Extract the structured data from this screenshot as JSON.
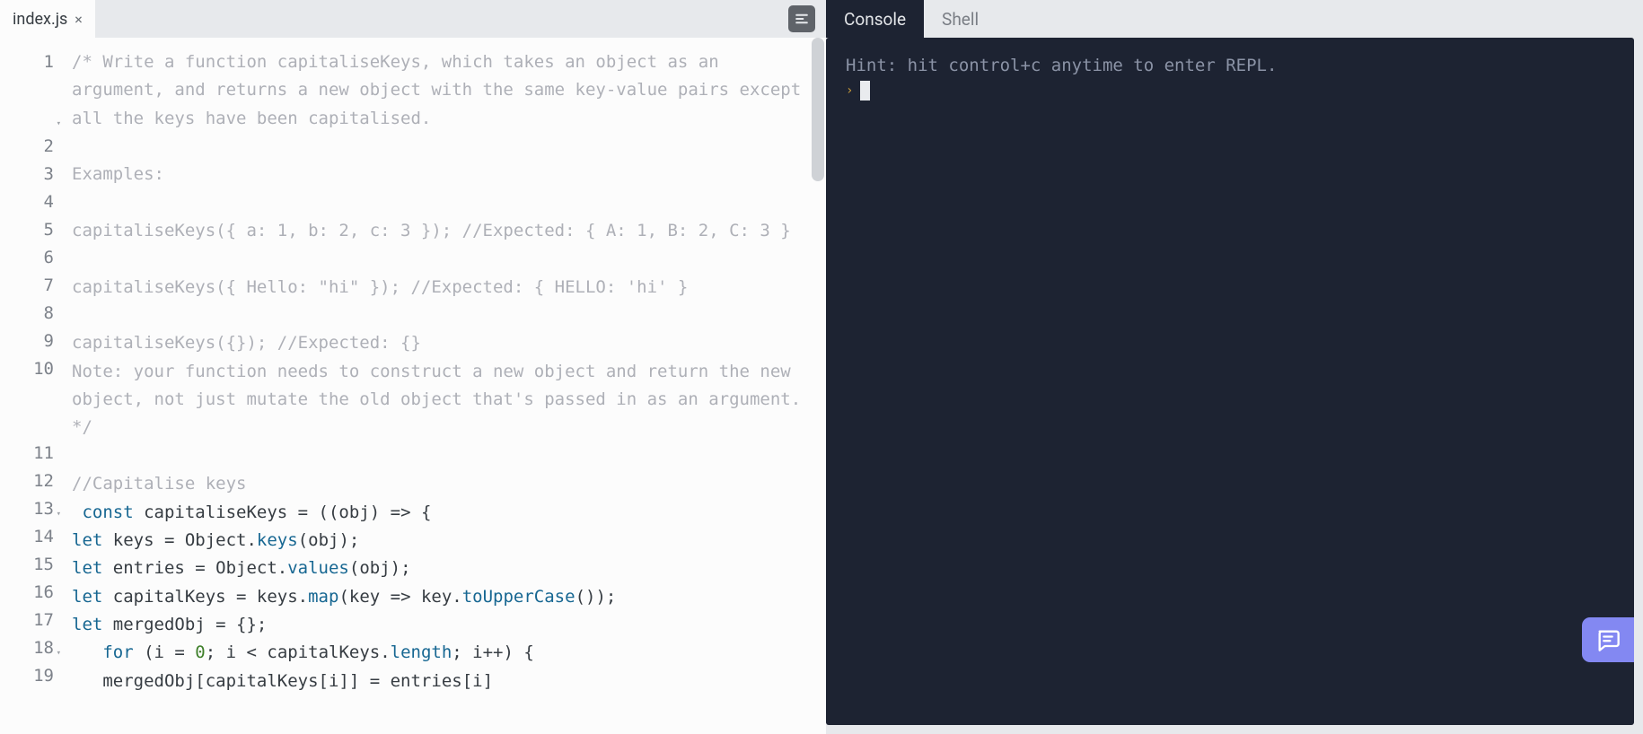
{
  "left": {
    "tab_filename": "index.js",
    "tab_close": "×"
  },
  "right": {
    "tabs": {
      "console": "Console",
      "shell": "Shell"
    }
  },
  "console": {
    "hint": "Hint: hit control+c anytime to enter REPL.",
    "prompt": "›"
  },
  "editor": {
    "lines": [
      {
        "n": 1,
        "fold": true,
        "type": "comment",
        "t": "/* Write a function capitaliseKeys, which takes an object as an argument, and returns a new object with the same key-value pairs except all the keys have been capitalised."
      },
      {
        "n": 2,
        "type": "blank",
        "t": ""
      },
      {
        "n": 3,
        "type": "comment",
        "t": "Examples:"
      },
      {
        "n": 4,
        "type": "blank",
        "t": ""
      },
      {
        "n": 5,
        "type": "comment",
        "t": "capitaliseKeys({ a: 1, b: 2, c: 3 }); //Expected: { A: 1, B: 2, C: 3 }"
      },
      {
        "n": 6,
        "type": "blank",
        "t": ""
      },
      {
        "n": 7,
        "type": "comment",
        "t": "capitaliseKeys({ Hello: \"hi\" }); //Expected: { HELLO: 'hi' }"
      },
      {
        "n": 8,
        "type": "blank",
        "t": ""
      },
      {
        "n": 9,
        "type": "comment",
        "t": "capitaliseKeys({}); //Expected: {}"
      },
      {
        "n": 10,
        "type": "comment",
        "t": "Note: your function needs to construct a new object and return the new object, not just mutate the old object that's passed in as an argument. */"
      },
      {
        "n": 11,
        "type": "blank",
        "t": ""
      },
      {
        "n": 12,
        "type": "linecomment",
        "t": "//Capitalise keys"
      },
      {
        "n": 13,
        "fold": true,
        "type": "code",
        "segs": [
          {
            "c": "plain",
            "t": " "
          },
          {
            "c": "kw",
            "t": "const"
          },
          {
            "c": "plain",
            "t": " capitaliseKeys = ((obj) => {"
          }
        ]
      },
      {
        "n": 14,
        "type": "code",
        "segs": [
          {
            "c": "kw",
            "t": "let"
          },
          {
            "c": "plain",
            "t": " keys = Object."
          },
          {
            "c": "prop",
            "t": "keys"
          },
          {
            "c": "plain",
            "t": "(obj);"
          }
        ]
      },
      {
        "n": 15,
        "type": "code",
        "segs": [
          {
            "c": "kw",
            "t": "let"
          },
          {
            "c": "plain",
            "t": " entries = Object."
          },
          {
            "c": "prop",
            "t": "values"
          },
          {
            "c": "plain",
            "t": "(obj);"
          }
        ]
      },
      {
        "n": 16,
        "type": "code",
        "segs": [
          {
            "c": "kw",
            "t": "let"
          },
          {
            "c": "plain",
            "t": " capitalKeys = keys."
          },
          {
            "c": "prop",
            "t": "map"
          },
          {
            "c": "plain",
            "t": "(key => key."
          },
          {
            "c": "prop",
            "t": "toUpperCase"
          },
          {
            "c": "plain",
            "t": "());"
          }
        ]
      },
      {
        "n": 17,
        "type": "code",
        "segs": [
          {
            "c": "kw",
            "t": "let"
          },
          {
            "c": "plain",
            "t": " mergedObj = {};"
          }
        ]
      },
      {
        "n": 18,
        "fold": true,
        "type": "code",
        "segs": [
          {
            "c": "plain",
            "t": "   "
          },
          {
            "c": "kw",
            "t": "for"
          },
          {
            "c": "plain",
            "t": " (i = "
          },
          {
            "c": "num",
            "t": "0"
          },
          {
            "c": "plain",
            "t": "; i < capitalKeys."
          },
          {
            "c": "prop",
            "t": "length"
          },
          {
            "c": "plain",
            "t": "; i++) {"
          }
        ]
      },
      {
        "n": 19,
        "type": "code",
        "segs": [
          {
            "c": "plain",
            "t": "   mergedObj[capitalKeys[i]] = entries[i]"
          }
        ]
      }
    ]
  }
}
